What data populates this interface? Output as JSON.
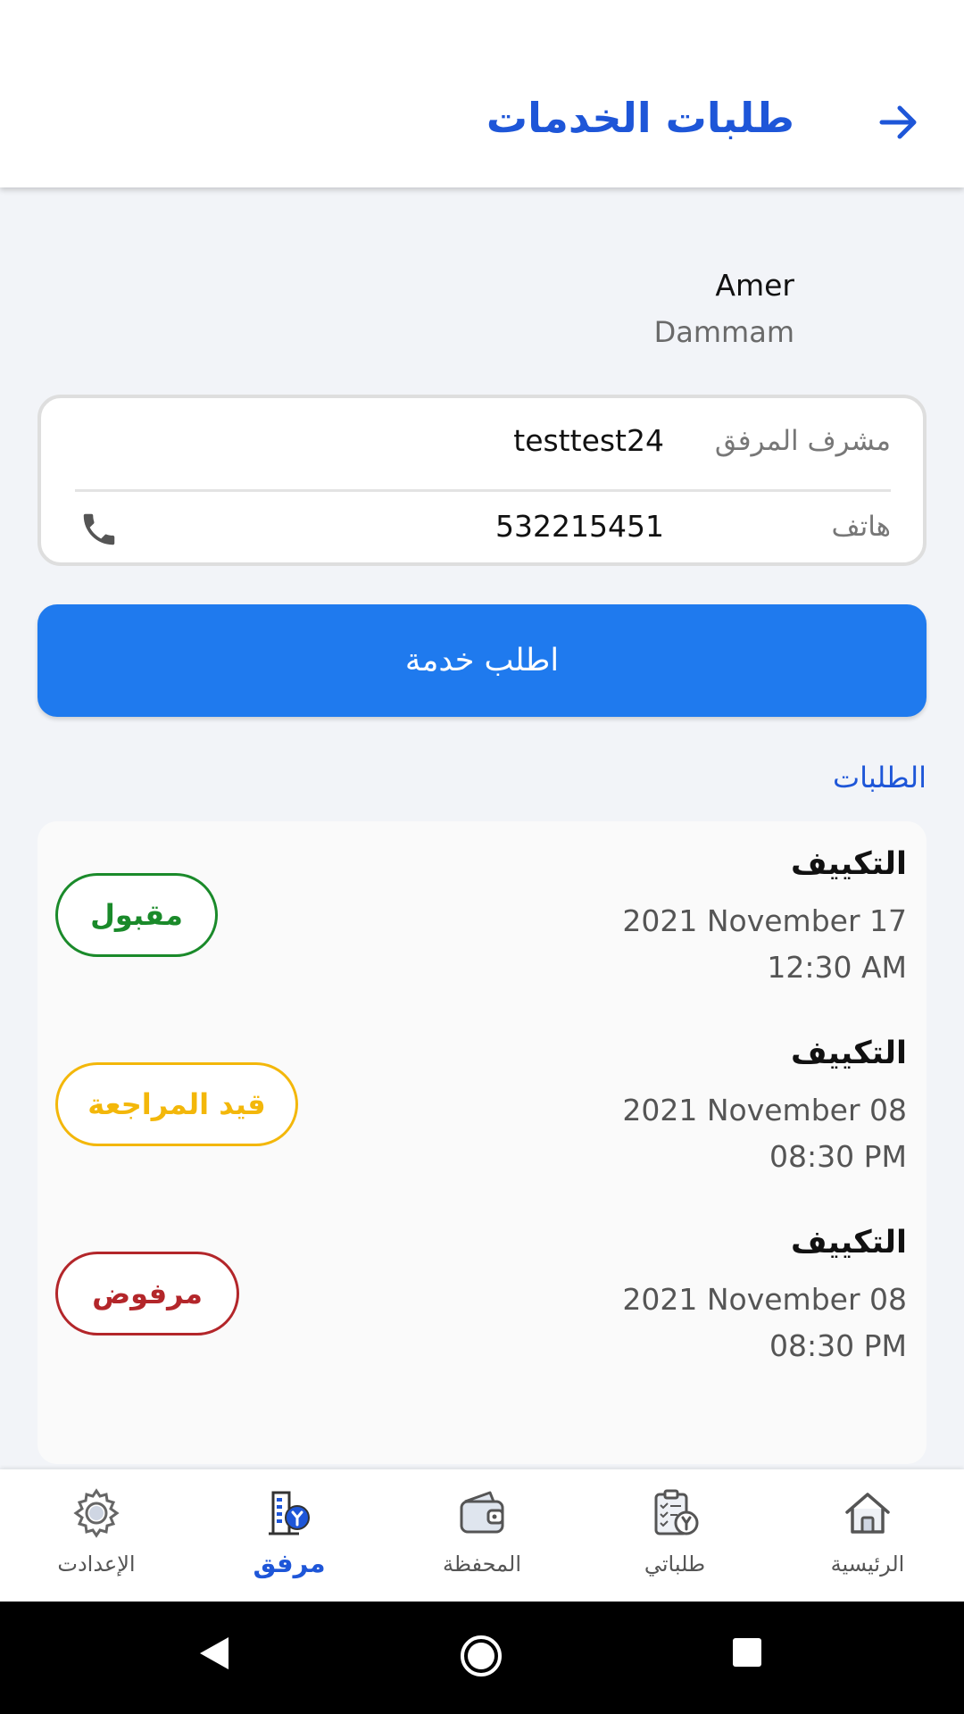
{
  "header": {
    "title": "طلبات الخدمات",
    "back_icon": "arrow-right-icon"
  },
  "profile": {
    "name": "Amer",
    "city": "Dammam"
  },
  "facility_info": {
    "supervisor_label": "مشرف المرفق",
    "supervisor_value": "testtest24",
    "phone_label": "هاتف",
    "phone_value": "532215451",
    "phone_icon": "phone-icon"
  },
  "request_button_label": "اطلب خدمة",
  "orders_section": {
    "title": "الطلبات",
    "items": [
      {
        "type": "التكييف",
        "date": "2021 November 17",
        "time": "12:30 AM",
        "status": "مقبول"
      },
      {
        "type": "التكييف",
        "date": "2021 November 08",
        "time": "08:30 PM",
        "status": "قيد المراجعة"
      },
      {
        "type": "التكييف",
        "date": "2021 November 08",
        "time": "08:30 PM",
        "status": "مرفوض"
      }
    ]
  },
  "bottom_nav": {
    "items": [
      {
        "label": "الإعدادت",
        "icon": "gear-icon",
        "active": false
      },
      {
        "label": "مرفق",
        "icon": "facility-icon",
        "active": true
      },
      {
        "label": "المحفظة",
        "icon": "wallet-icon",
        "active": false
      },
      {
        "label": "طلباتي",
        "icon": "clipboard-icon",
        "active": false
      },
      {
        "label": "الرئيسية",
        "icon": "home-icon",
        "active": false
      }
    ]
  },
  "colors": {
    "brand_blue": "#1e56d8",
    "button_blue": "#1f7aee",
    "accepted": "#1a8a2a",
    "review": "#f3b70a",
    "rejected": "#b3262a"
  }
}
